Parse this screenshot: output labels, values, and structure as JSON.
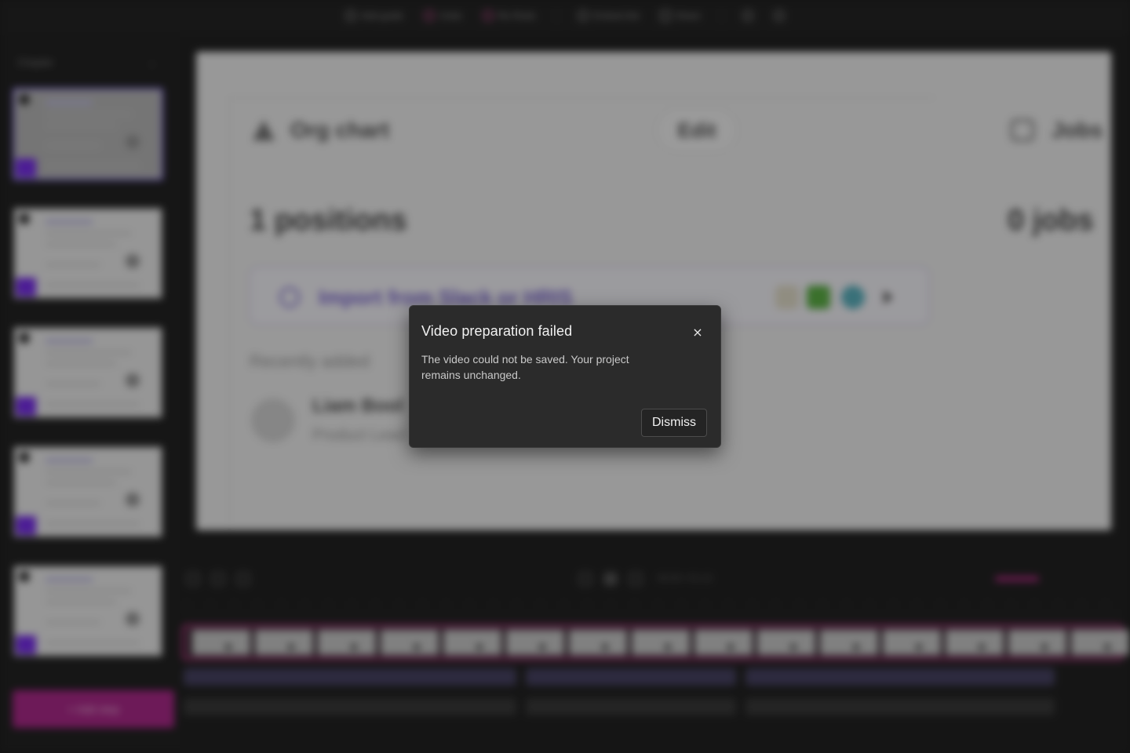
{
  "toolbar": {
    "items": [
      {
        "label": "Add guide",
        "icon": "plus-circle-icon"
      },
      {
        "label": "Undo",
        "icon": "undo-icon"
      },
      {
        "label": "Re-Redo",
        "icon": "redo-icon"
      },
      {
        "label": "Embed link",
        "icon": "link-icon"
      },
      {
        "label": "Share",
        "icon": "share-icon"
      }
    ]
  },
  "sidebar": {
    "title": "Chapter",
    "add_step_label": "+ Add step"
  },
  "preview": {
    "org_chart_title": "Org chart",
    "edit_label": "Edit",
    "jobs_title": "Jobs",
    "positions_count": "1 positions",
    "jobs_count": "0 jobs",
    "import_text": "Import from Slack or HRIS",
    "recent_label": "Recently added",
    "person_name": "Liam Bool",
    "person_role": "Product Lead"
  },
  "timeline": {
    "time_readout": "00:00 / 01:12"
  },
  "dialog": {
    "title": "Video preparation failed",
    "message": "The video could not be saved. Your project remains unchanged.",
    "close_icon": "×",
    "dismiss_label": "Dismiss"
  },
  "colors": {
    "accent_pink": "#d13d95",
    "accent_purple": "#7b5cff",
    "dialog_bg": "#2b2b2b"
  }
}
